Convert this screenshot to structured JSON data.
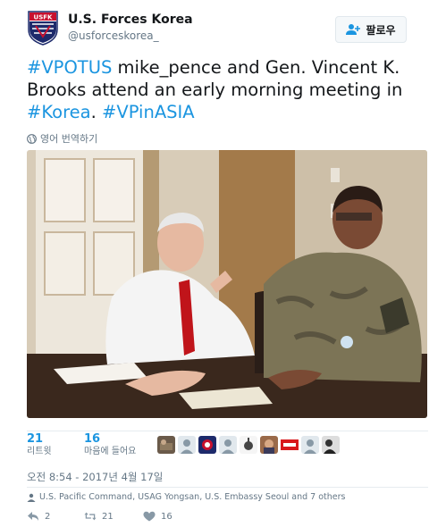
{
  "account": {
    "avatar_text": "USFK",
    "name": "U.S. Forces Korea",
    "handle": "@usforceskorea_"
  },
  "follow_button": {
    "label": "팔로우"
  },
  "tweet": {
    "segments": [
      {
        "text": "#VPOTUS",
        "tag": true
      },
      {
        "text": " mike_pence and Gen. Vincent K. Brooks attend an early morning meeting in ",
        "tag": false
      },
      {
        "text": "#Korea",
        "tag": true
      },
      {
        "text": ". ",
        "tag": false
      },
      {
        "text": "#VPinASIA",
        "tag": true
      }
    ],
    "translate_label": "영어 번역하기"
  },
  "stats": {
    "retweets": {
      "count": "21",
      "label": "리트윗"
    },
    "likes": {
      "count": "16",
      "label": "마음에 들어요"
    },
    "liker_count": 9
  },
  "timestamp": "오전 8:54 - 2017년 4월 17일",
  "location": "U.S. Pacific Command, USAG Yongsan, U.S. Embassy Seoul and 7 others",
  "actions": {
    "reply": {
      "icon": "reply-icon",
      "count": "2"
    },
    "retweet": {
      "icon": "retweet-icon",
      "count": "21"
    },
    "like": {
      "icon": "heart-icon",
      "count": "16"
    }
  },
  "colors": {
    "link": "#1b95e0",
    "secondary_text": "#657786",
    "primary_text": "#14171a",
    "divider": "#e6ecf0"
  }
}
